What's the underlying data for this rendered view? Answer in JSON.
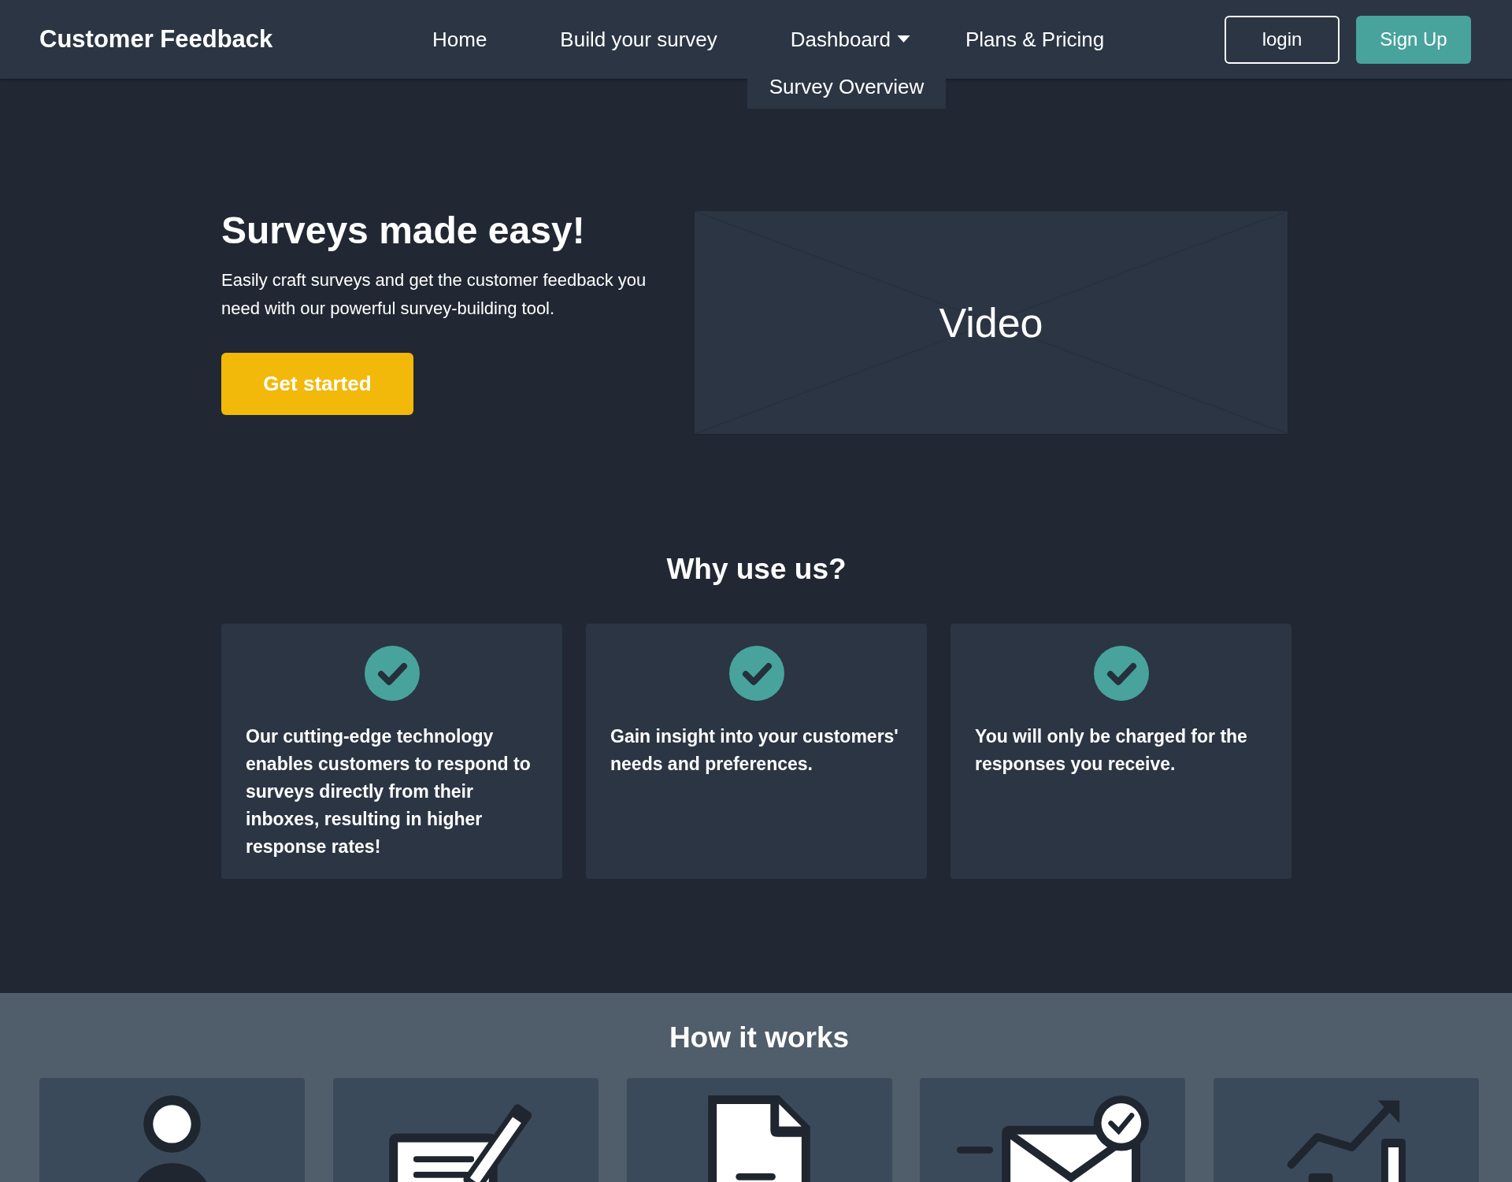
{
  "navbar": {
    "brand": "Customer Feedback",
    "links": [
      {
        "label": "Home",
        "has_dropdown": false
      },
      {
        "label": "Build your survey",
        "has_dropdown": false
      },
      {
        "label": "Dashboard",
        "has_dropdown": true,
        "expanded": true,
        "dropdown_items": [
          "Survey Overview"
        ]
      },
      {
        "label": "Plans & Pricing",
        "has_dropdown": false
      }
    ],
    "buttons": [
      {
        "label": "login",
        "kind": "outline"
      },
      {
        "label": "Sign Up",
        "kind": "filled"
      }
    ]
  },
  "hero": {
    "title": "Surveys made easy!",
    "text": "Easily craft surveys and get the customer feedback you need with our powerful survey-building tool.",
    "button": "Get started",
    "video": {
      "label": "Video"
    }
  },
  "why": {
    "title": "Why use us?",
    "cards": [
      {
        "text": "Our cutting-edge technology enables customers to respond to surveys directly from their inboxes, resulting in higher response rates!"
      },
      {
        "text": "Gain insight into your customers' needs and preferences."
      },
      {
        "text": "You will only be charged for the responses you receive."
      }
    ]
  },
  "how": {
    "title": "How it works",
    "steps": [
      {
        "kind": "person"
      },
      {
        "kind": "edit"
      },
      {
        "kind": "document"
      },
      {
        "kind": "mail"
      },
      {
        "kind": "growth"
      }
    ]
  }
}
